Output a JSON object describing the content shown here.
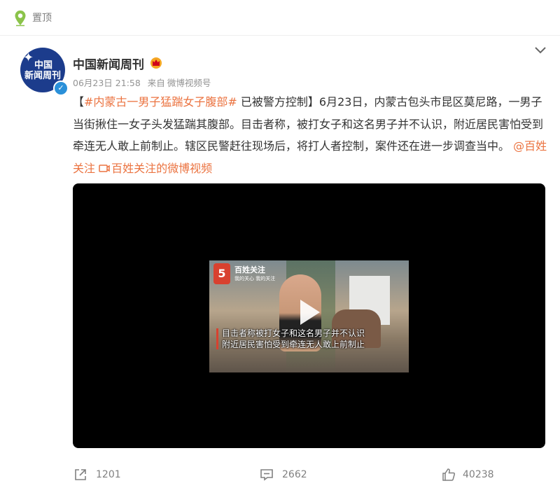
{
  "pinned": {
    "label": "置顶"
  },
  "post": {
    "author": "中国新闻周刊",
    "avatar_text": "中国\n新闻周刊",
    "timestamp": "06月23日 21:58",
    "source_prefix": "来自",
    "source": "微博视频号",
    "text": {
      "bracket_open": "【",
      "hashtag": "#内蒙古一男子猛踹女子腹部#",
      "headline_rest": " 已被警方控制】6月23日，内蒙古包头市昆区莫尼路，一男子当街揪住一女子头发猛踹其腹部。目击者称，被打女子和这名男子并不认识，附近居民害怕受到牵连无人敢上前制止。辖区民警赶往现场后，将打人者控制，案件还在进一步调查当中。 ",
      "mention": "@百姓关注",
      "video_link": "百姓关注的微博视频"
    },
    "video": {
      "logo_title": "百姓关注",
      "logo_sub": "我的关心 我的关注",
      "caption": "目击者称被打女子和这名男子并不认识\n附近居民害怕受到牵连无人敢上前制止"
    },
    "actions": {
      "shares": "1201",
      "comments": "2662",
      "likes": "40238"
    }
  },
  "colors": {
    "accent": "#eb7340",
    "verified": "#2a90d9",
    "pin": "#8bc34a"
  }
}
